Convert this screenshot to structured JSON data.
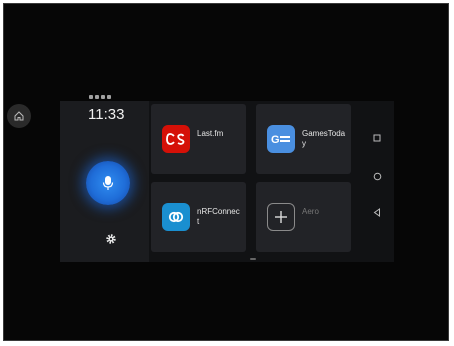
{
  "status_bar": {
    "left": "",
    "right": ""
  },
  "clock": "11:33",
  "apps": [
    {
      "label": "Last.fm",
      "icon": "lastfm-icon",
      "color": "#d51007"
    },
    {
      "label": "GamesToday",
      "icon": "gamestoday-icon",
      "color": "#4a8fe0"
    },
    {
      "label": "nRFConnect",
      "icon": "nrfconnect-icon",
      "color": "#1a8fd0"
    },
    {
      "label": "Aero",
      "icon": "add-icon",
      "color": "#2a2b2f"
    }
  ],
  "icons": {
    "home": "home-icon",
    "mic": "microphone-icon",
    "settings": "gear-icon",
    "recents": "square-icon",
    "nav_home": "circle-icon",
    "back": "triangle-back-icon"
  },
  "colors": {
    "accent": "#1f6dd8",
    "background": "#111214",
    "tile": "#222327"
  }
}
